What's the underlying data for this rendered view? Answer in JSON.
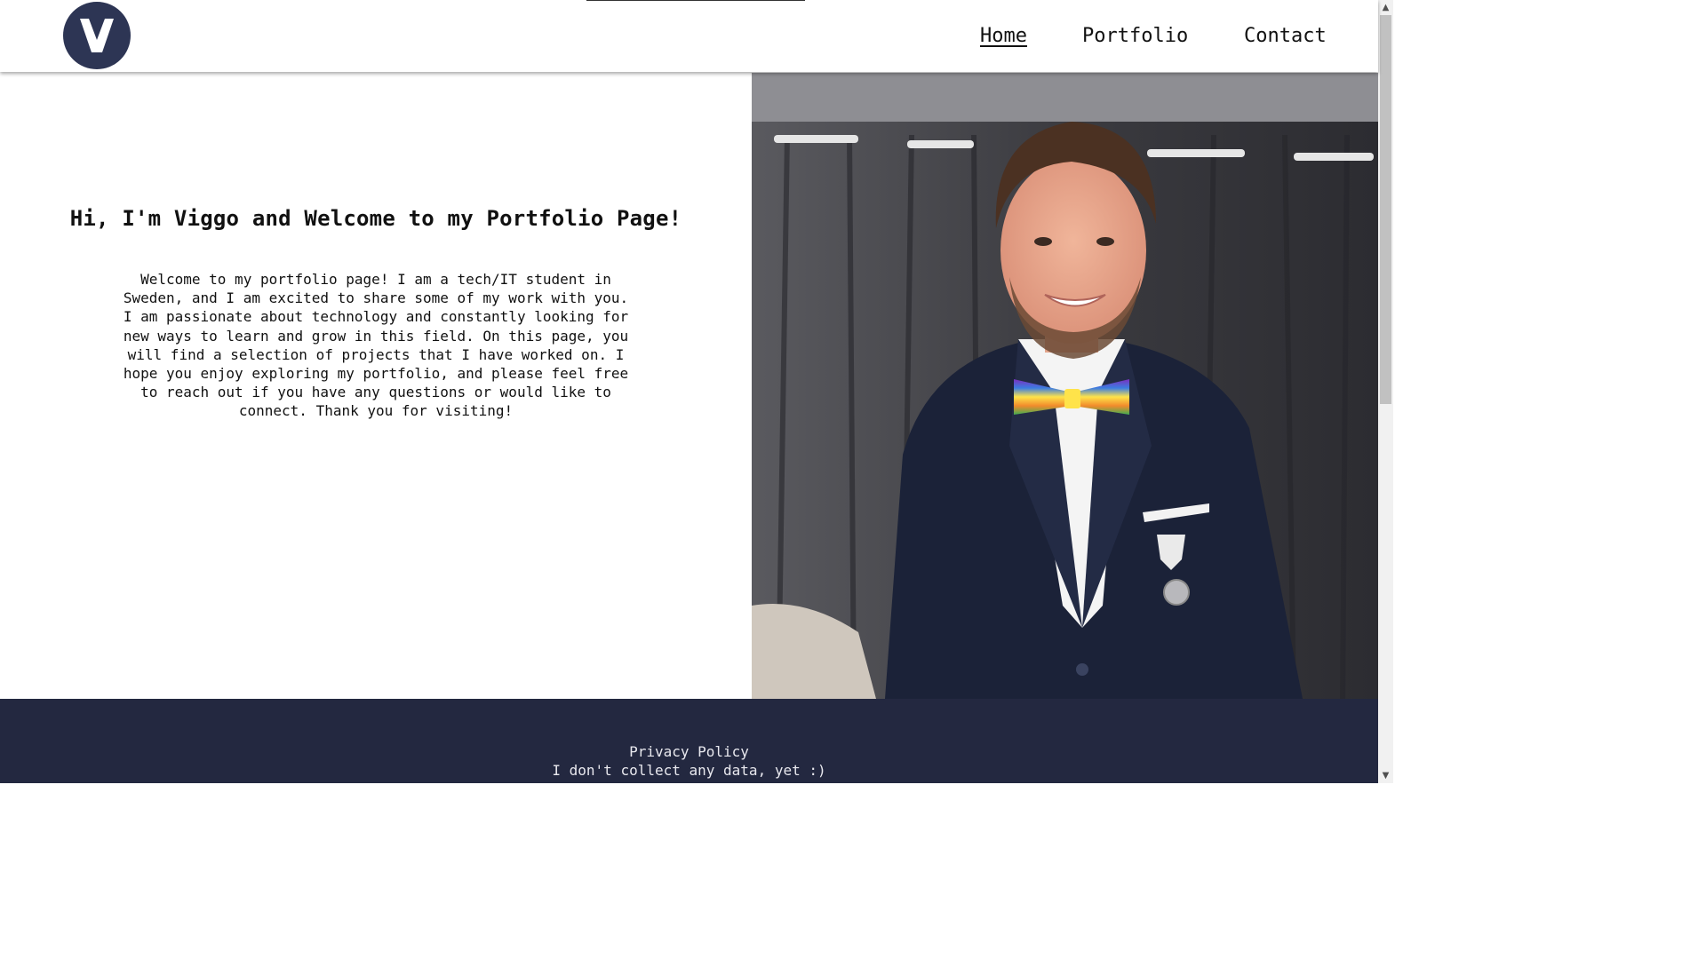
{
  "logo": {
    "letter": "V",
    "icon": "logo-v-icon",
    "color": "#2d3554"
  },
  "nav": {
    "items": [
      {
        "label": "Home",
        "active": true
      },
      {
        "label": "Portfolio",
        "active": false
      },
      {
        "label": "Contact",
        "active": false
      }
    ]
  },
  "intro": {
    "heading": "Hi, I'm Viggo and Welcome to my Portfolio Page!",
    "body": "Welcome to my portfolio page! I am a tech/IT student in Sweden, and I am excited to share some of my work with you. I am passionate about technology and constantly looking for new ways to learn and grow in this field. On this page, you will find a selection of projects that I have worked on. I hope you enjoy exploring my portfolio, and please feel free to reach out if you have any questions or would like to connect. Thank you for visiting!"
  },
  "photo": {
    "icon": "portrait-photo"
  },
  "footer": {
    "privacy_label": "Privacy Policy",
    "note": "I don't collect any data, yet :)",
    "background": "#232840"
  },
  "colors": {
    "accent": "#2d3554"
  }
}
